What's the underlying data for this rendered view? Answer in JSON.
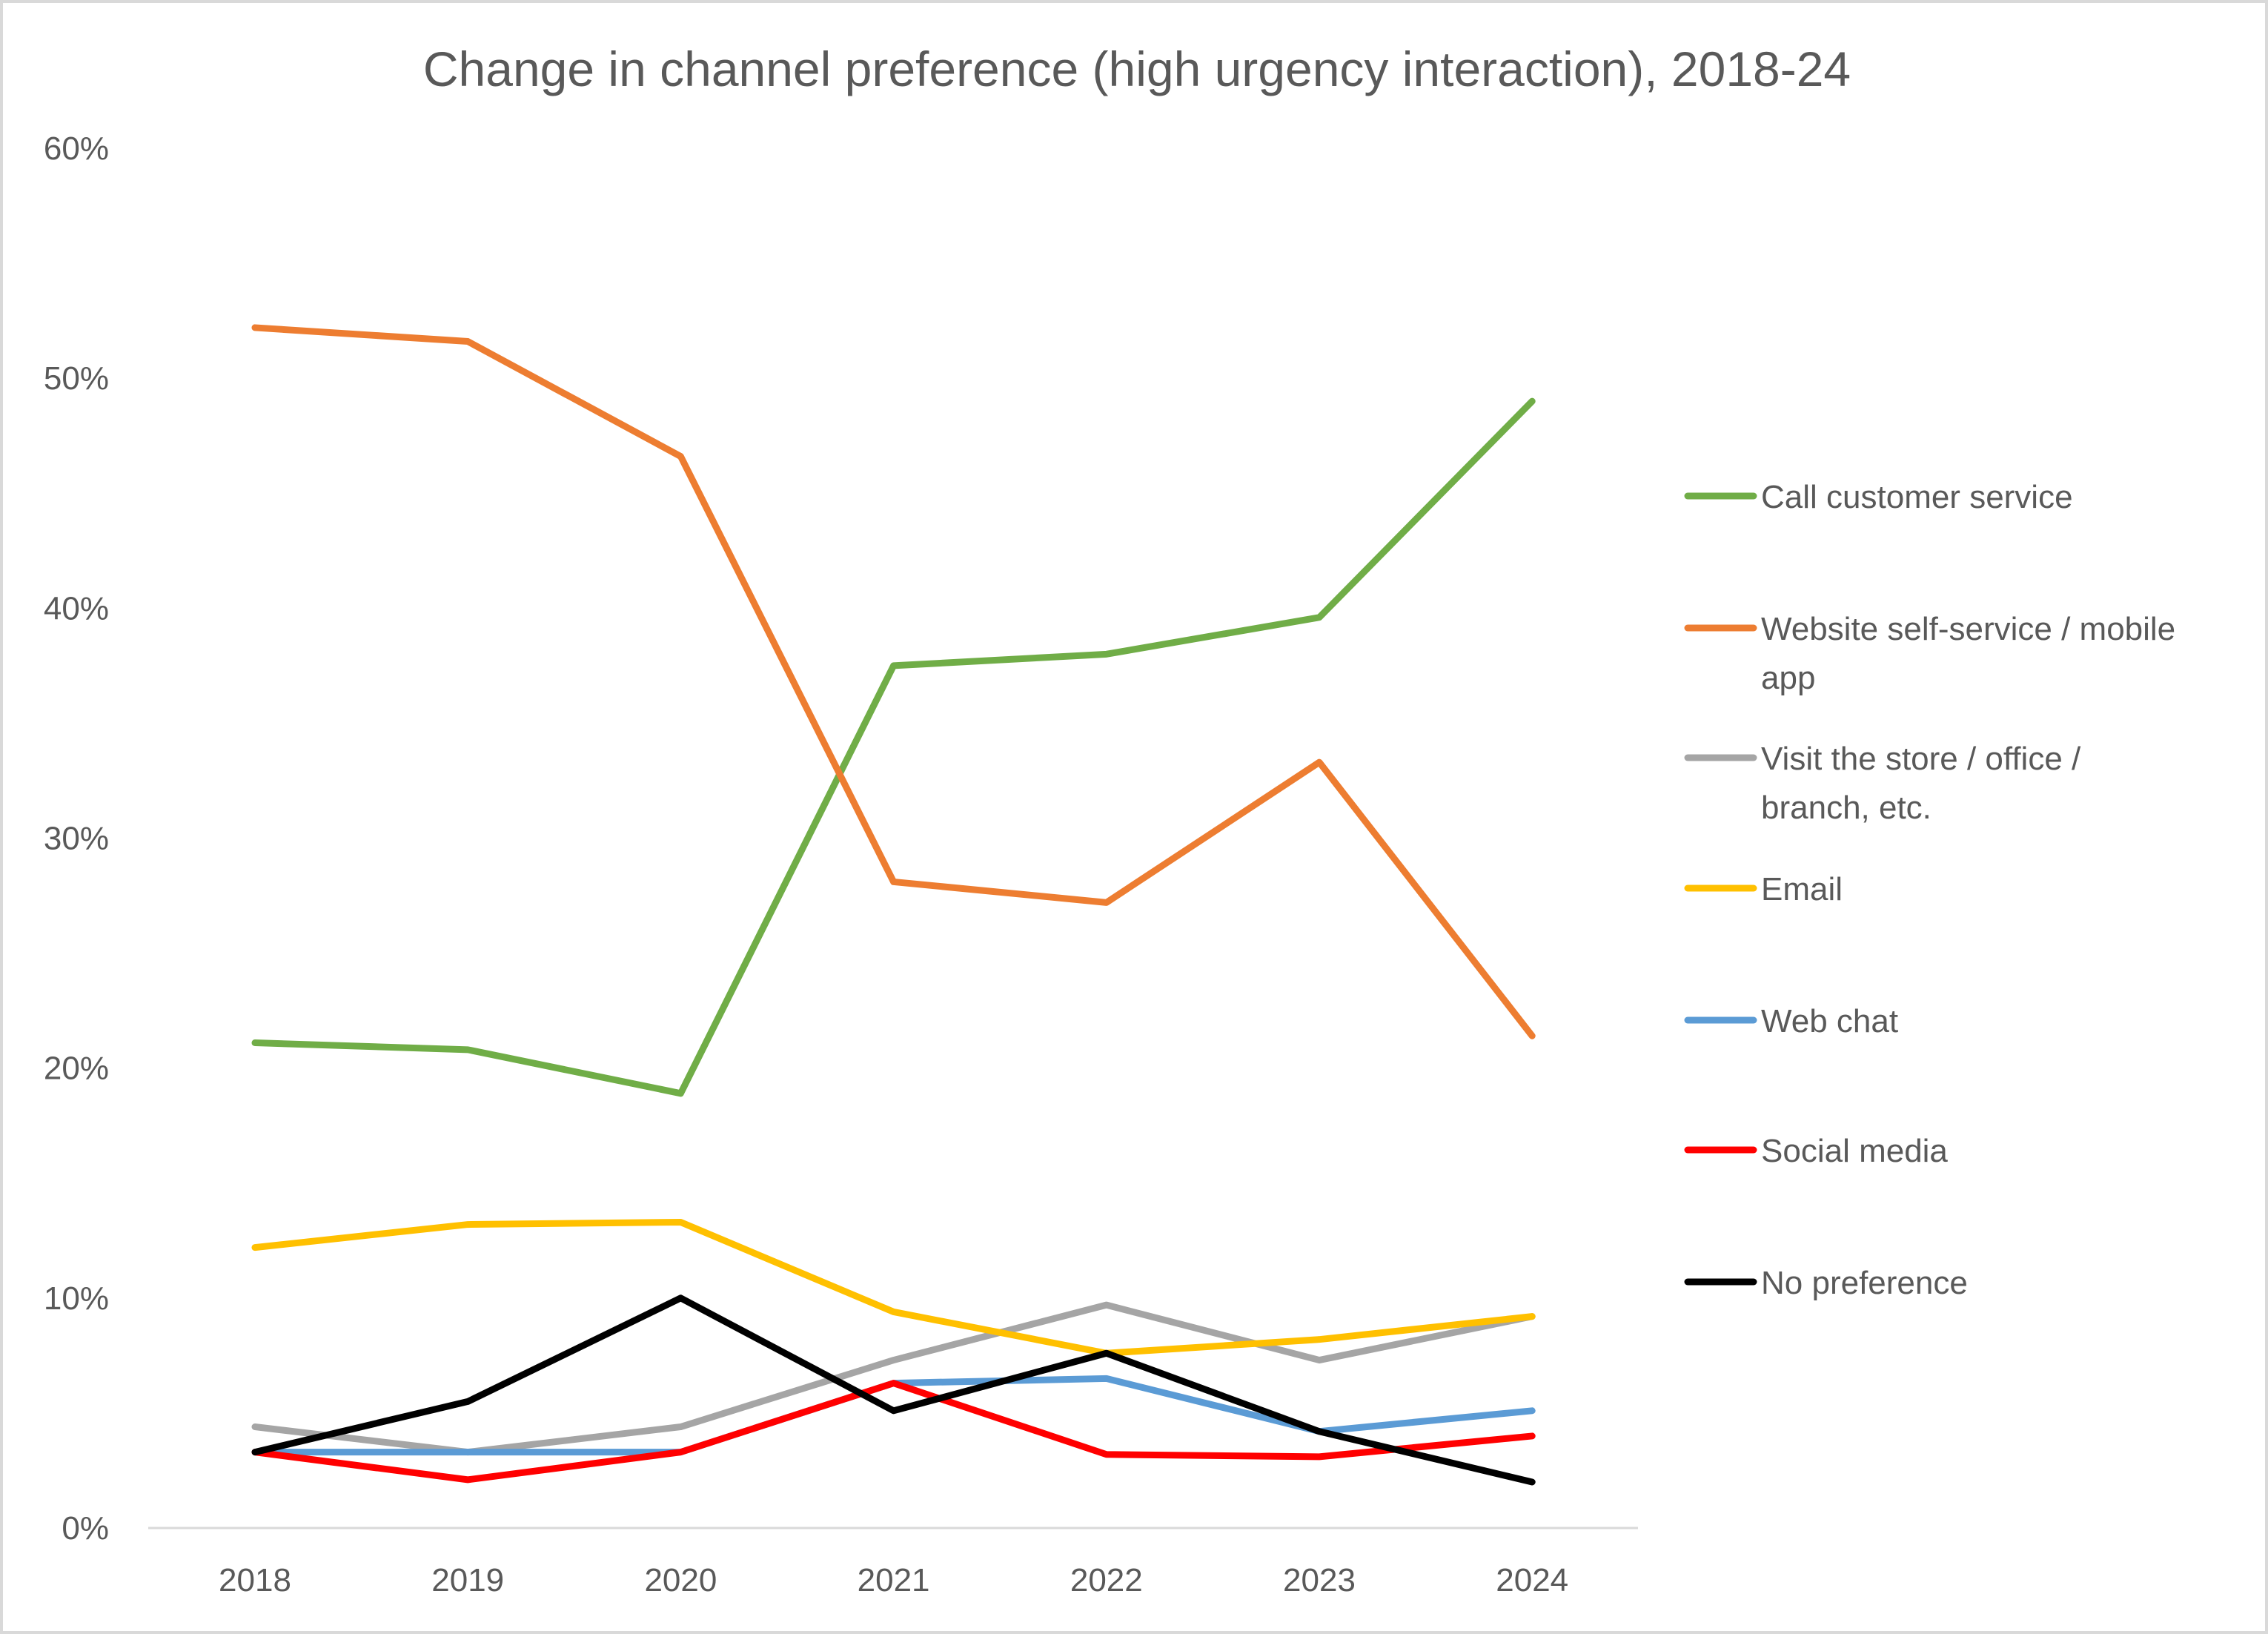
{
  "chart_data": {
    "type": "line",
    "title": "Change in channel preference (high urgency interaction), 2018-24",
    "xlabel": "",
    "ylabel": "",
    "categories": [
      "2018",
      "2019",
      "2020",
      "2021",
      "2022",
      "2023",
      "2024"
    ],
    "ylim": [
      0,
      60
    ],
    "y_ticks": [
      0,
      10,
      20,
      30,
      40,
      50,
      60
    ],
    "y_tick_labels": [
      "0%",
      "10%",
      "20%",
      "30%",
      "40%",
      "50%",
      "60%"
    ],
    "grid": false,
    "legend_position": "right",
    "series": [
      {
        "name": "Call customer service",
        "color": "#70ad47",
        "values": [
          21.1,
          20.8,
          18.9,
          37.5,
          38.0,
          39.6,
          49.0
        ]
      },
      {
        "name": "Website self-service / mobile app",
        "color": "#ed7d31",
        "values": [
          52.2,
          51.6,
          46.6,
          28.1,
          27.2,
          33.3,
          21.4
        ]
      },
      {
        "name": "Visit the store / office / branch, etc.",
        "color": "#a5a5a5",
        "values": [
          4.4,
          3.3,
          4.4,
          7.3,
          9.7,
          7.3,
          9.2
        ]
      },
      {
        "name": "Email",
        "color": "#ffc000",
        "values": [
          12.2,
          13.2,
          13.3,
          9.4,
          7.6,
          8.2,
          9.2
        ]
      },
      {
        "name": "Web chat",
        "color": "#5b9bd5",
        "values": [
          3.3,
          3.3,
          3.3,
          6.3,
          6.5,
          4.2,
          5.1
        ]
      },
      {
        "name": "Social media",
        "color": "#ff0000",
        "values": [
          3.3,
          2.1,
          3.3,
          6.3,
          3.2,
          3.1,
          4.0
        ]
      },
      {
        "name": "No preference",
        "color": "#000000",
        "values": [
          3.3,
          5.5,
          10.0,
          5.1,
          7.6,
          4.2,
          2.0
        ]
      }
    ],
    "legend": [
      {
        "lines": [
          "Call customer service"
        ]
      },
      {
        "lines": [
          "Website self-service / mobile",
          "app"
        ]
      },
      {
        "lines": [
          "Visit the store / office /",
          "branch, etc."
        ]
      },
      {
        "lines": [
          "Email"
        ]
      },
      {
        "lines": [
          "Web chat"
        ]
      },
      {
        "lines": [
          "Social media"
        ]
      },
      {
        "lines": [
          "No preference"
        ]
      }
    ]
  }
}
